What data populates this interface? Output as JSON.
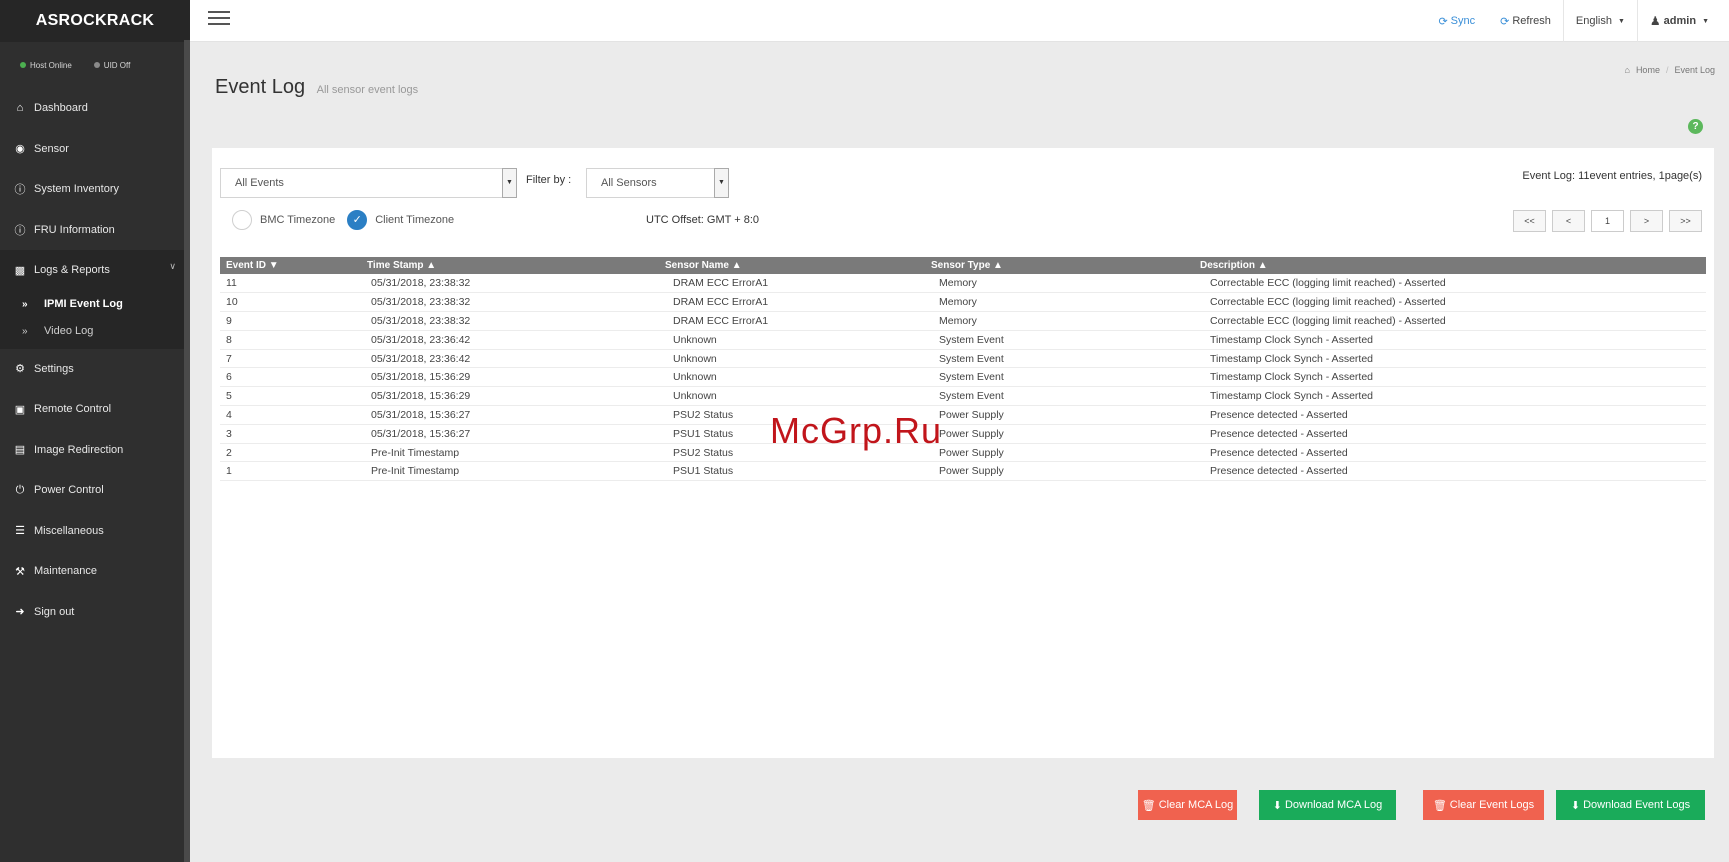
{
  "brand": "ASROCKRACK",
  "status": {
    "host": {
      "label": "Host Online",
      "color": "#4caf50"
    },
    "uid": {
      "label": "UID Off",
      "color": "#8a8a8a"
    }
  },
  "sidebar": {
    "items": [
      {
        "label": "Dashboard",
        "icon": "home-icon"
      },
      {
        "label": "Sensor",
        "icon": "dashboard-icon"
      },
      {
        "label": "System Inventory",
        "icon": "info-icon"
      },
      {
        "label": "FRU Information",
        "icon": "info-icon"
      },
      {
        "label": "Logs & Reports",
        "icon": "bar-chart-icon"
      },
      {
        "label": "Settings",
        "icon": "gear-icon"
      },
      {
        "label": "Remote Control",
        "icon": "monitor-icon"
      },
      {
        "label": "Image Redirection",
        "icon": "disk-icon"
      },
      {
        "label": "Power Control",
        "icon": "power-icon"
      },
      {
        "label": "Miscellaneous",
        "icon": "list-icon"
      },
      {
        "label": "Maintenance",
        "icon": "wrench-icon"
      },
      {
        "label": "Sign out",
        "icon": "sign-out-icon"
      }
    ],
    "subitems": [
      {
        "label": "IPMI Event Log",
        "active": true
      },
      {
        "label": "Video Log",
        "active": false
      }
    ]
  },
  "topbar": {
    "sync": "Sync",
    "refresh": "Refresh",
    "language": "English",
    "user": "admin"
  },
  "page": {
    "title": "Event Log",
    "subtitle": "All sensor event logs",
    "breadcrumb_home": "Home",
    "breadcrumb_current": "Event Log"
  },
  "filters": {
    "event_select": "All Events",
    "filter_label": "Filter by :",
    "sensor_select": "All Sensors",
    "bmc_timezone": "BMC Timezone",
    "client_timezone": "Client Timezone",
    "utc_offset": "UTC Offset: GMT + 8:0",
    "entries_summary": "Event Log: 11event entries, 1page(s)"
  },
  "pager": {
    "first": "<<",
    "prev": "<",
    "current": "1",
    "next": ">",
    "last": ">>"
  },
  "table": {
    "headers": [
      "Event ID ▼",
      "Time Stamp ▲",
      "Sensor Name ▲",
      "Sensor Type ▲",
      "Description ▲"
    ],
    "rows": [
      [
        "11",
        "05/31/2018, 23:38:32",
        "DRAM ECC ErrorA1",
        "Memory",
        "Correctable ECC (logging limit reached) - Asserted"
      ],
      [
        "10",
        "05/31/2018, 23:38:32",
        "DRAM ECC ErrorA1",
        "Memory",
        "Correctable ECC (logging limit reached) - Asserted"
      ],
      [
        "9",
        "05/31/2018, 23:38:32",
        "DRAM ECC ErrorA1",
        "Memory",
        "Correctable ECC (logging limit reached) - Asserted"
      ],
      [
        "8",
        "05/31/2018, 23:36:42",
        "Unknown",
        "System Event",
        "Timestamp Clock Synch - Asserted"
      ],
      [
        "7",
        "05/31/2018, 23:36:42",
        "Unknown",
        "System Event",
        "Timestamp Clock Synch - Asserted"
      ],
      [
        "6",
        "05/31/2018, 15:36:29",
        "Unknown",
        "System Event",
        "Timestamp Clock Synch - Asserted"
      ],
      [
        "5",
        "05/31/2018, 15:36:29",
        "Unknown",
        "System Event",
        "Timestamp Clock Synch - Asserted"
      ],
      [
        "4",
        "05/31/2018, 15:36:27",
        "PSU2 Status",
        "Power Supply",
        "Presence detected - Asserted"
      ],
      [
        "3",
        "05/31/2018, 15:36:27",
        "PSU1 Status",
        "Power Supply",
        "Presence detected - Asserted"
      ],
      [
        "2",
        "Pre-Init Timestamp",
        "PSU2 Status",
        "Power Supply",
        "Presence detected - Asserted"
      ],
      [
        "1",
        "Pre-Init Timestamp",
        "PSU1 Status",
        "Power Supply",
        "Presence detected - Asserted"
      ]
    ]
  },
  "buttons": {
    "clear_mca": "Clear MCA Log",
    "download_mca": "Download MCA Log",
    "clear_event": "Clear Event Logs",
    "download_event": "Download Event Logs"
  },
  "watermark": "McGrp.Ru",
  "colors": {
    "sidebar_bg": "#2f2f2f",
    "accent_blue": "#2b7fc4",
    "button_red": "#f0624f",
    "button_green": "#1aab5a",
    "table_header": "#7a7a7a"
  }
}
